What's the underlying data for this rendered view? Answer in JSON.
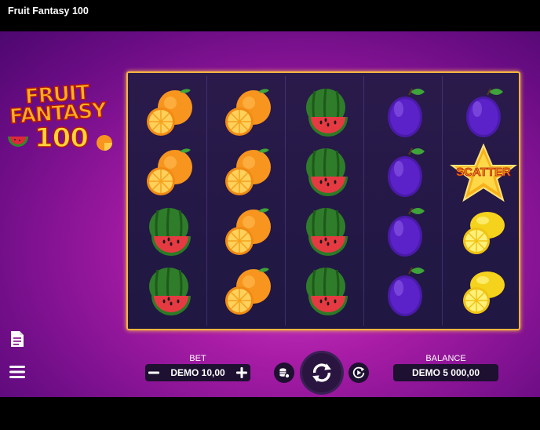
{
  "window": {
    "title": "Fruit Fantasy 100"
  },
  "logo": {
    "line1": "FRUIT",
    "line2": "FANTASY",
    "line3": "100"
  },
  "reels": [
    [
      "orange",
      "orange",
      "watermelon",
      "watermelon"
    ],
    [
      "orange",
      "orange",
      "orange",
      "orange"
    ],
    [
      "watermelon",
      "watermelon",
      "watermelon",
      "watermelon"
    ],
    [
      "plum",
      "plum",
      "plum",
      "plum"
    ],
    [
      "plum",
      "scatter",
      "lemon",
      "lemon"
    ]
  ],
  "scatter_label": "SCATTER",
  "bet": {
    "label": "BET",
    "value": "DEMO 10,00"
  },
  "balance": {
    "label": "BALANCE",
    "value": "DEMO 5 000,00"
  },
  "icons": {
    "paytable": "document-icon",
    "menu": "hamburger-menu-icon",
    "bet_minus": "minus-icon",
    "bet_plus": "plus-icon",
    "bet_settings": "coins-settings-icon",
    "spin": "spin-arrows-icon",
    "autoplay": "autoplay-icon"
  },
  "colors": {
    "background": "#a81ca6",
    "frame_border": "#f2b441",
    "reels_bg": "#241845",
    "pill_bg": "#1d1030"
  }
}
